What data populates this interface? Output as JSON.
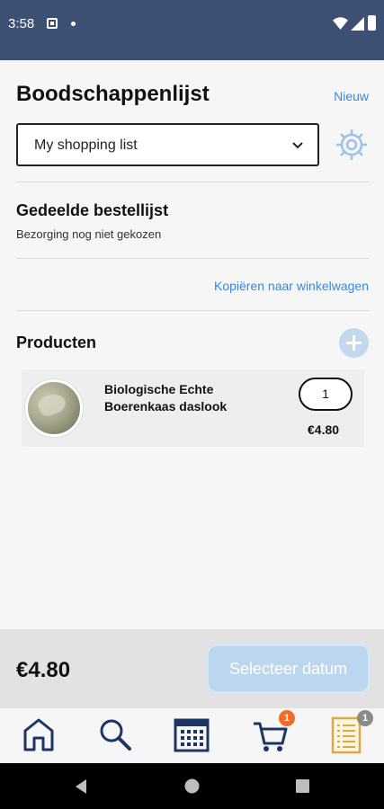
{
  "status_bar": {
    "time": "3:58"
  },
  "header": {
    "title": "Boodschappenlijst",
    "new_label": "Nieuw"
  },
  "list_select": {
    "selected": "My shopping list"
  },
  "shared_list": {
    "title": "Gedeelde bestellijst",
    "subtitle": "Bezorging nog niet gekozen"
  },
  "copy_link": "Kopiëren naar winkelwagen",
  "products": {
    "title": "Producten",
    "items": [
      {
        "name": "Biologische Echte Boerenkaas daslook",
        "quantity": "1",
        "price": "€4.80"
      }
    ]
  },
  "footer": {
    "total": "€4.80",
    "select_date_label": "Selecteer datum"
  },
  "tab_bar": {
    "tabs": [
      {
        "icon": "home-icon"
      },
      {
        "icon": "search-icon"
      },
      {
        "icon": "calendar-icon"
      },
      {
        "icon": "cart-icon",
        "badge": "1",
        "badge_color": "#f26b2a"
      },
      {
        "icon": "shopping-list-icon",
        "badge": "1",
        "badge_color": "#8a8a8a"
      }
    ]
  },
  "colors": {
    "status_bar": "#3d4f72",
    "link": "#3a87d8",
    "navy_icon": "#1d3566",
    "list_icon": "#d9a94a",
    "button_disabled": "#bcd6ef"
  }
}
